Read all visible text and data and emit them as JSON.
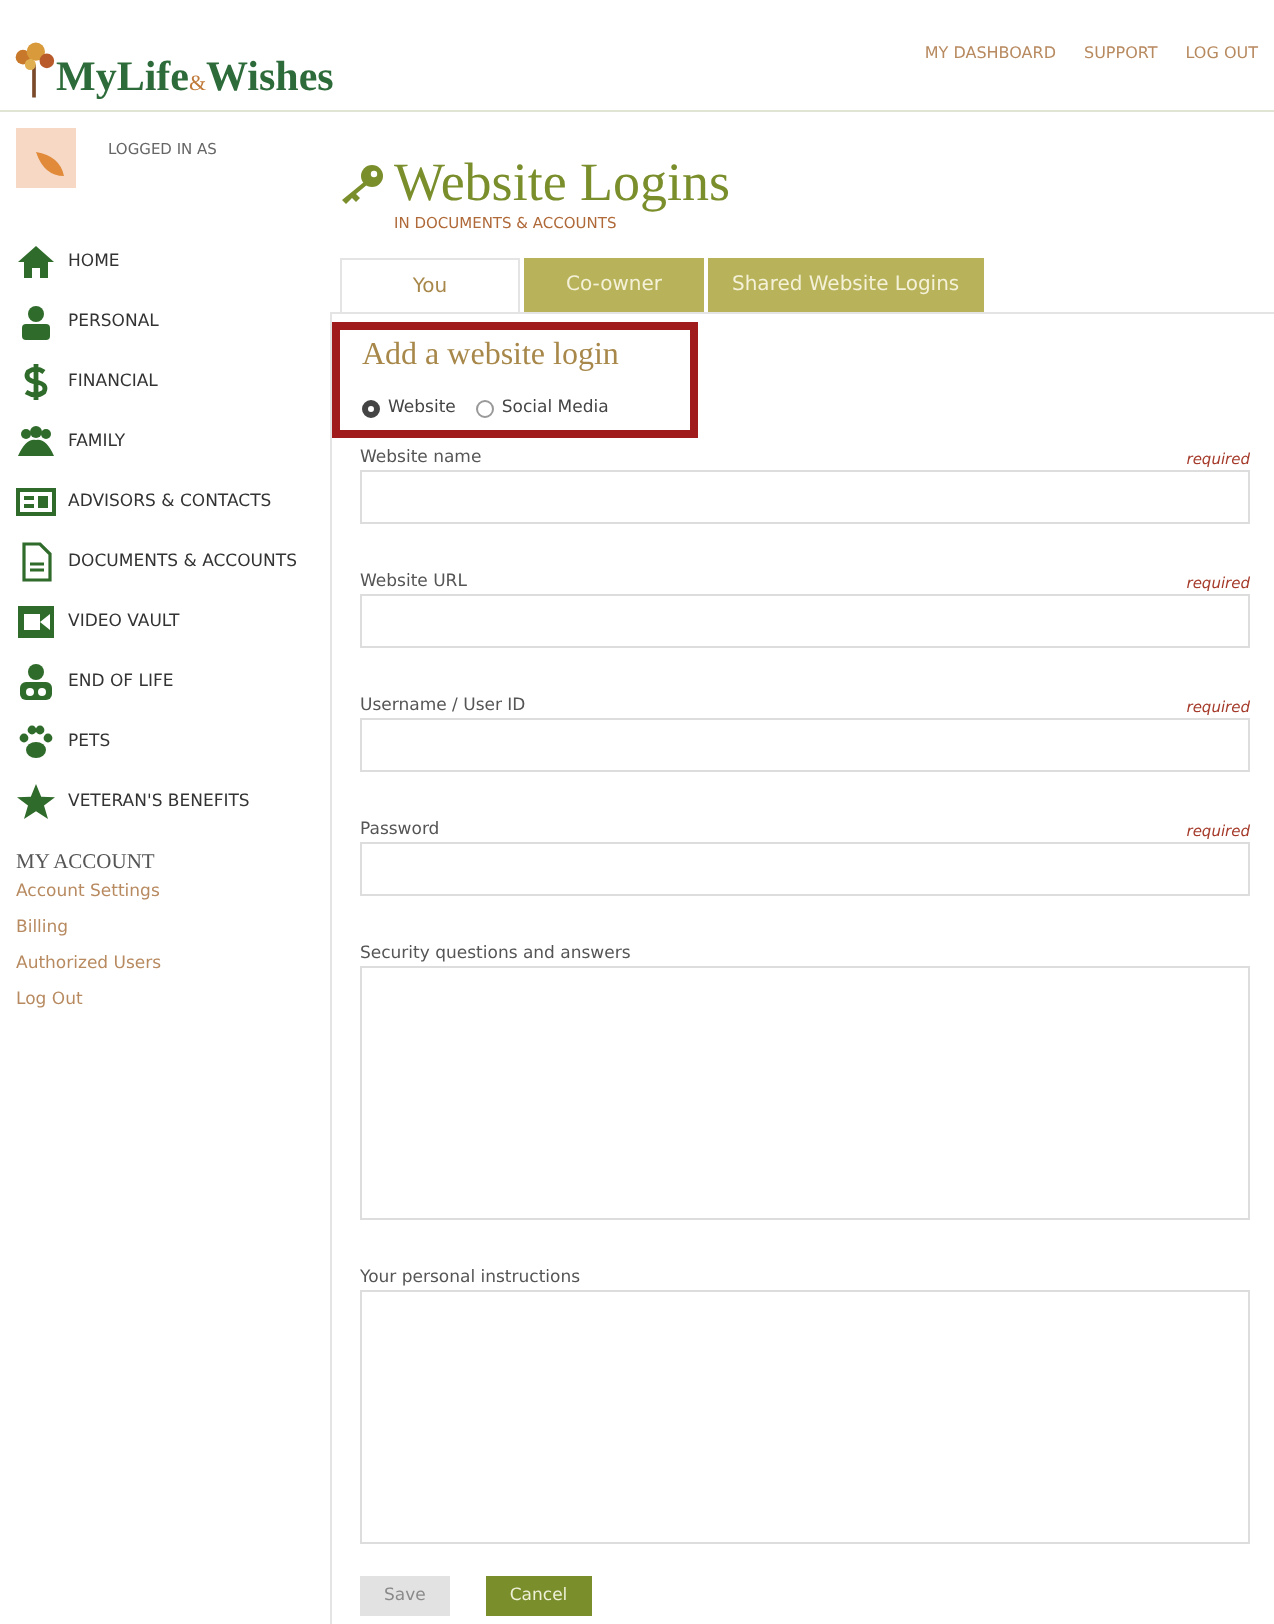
{
  "header": {
    "logo": [
      "MyLife",
      "&",
      "Wishes"
    ],
    "nav": [
      "MY DASHBOARD",
      "SUPPORT",
      "LOG OUT"
    ]
  },
  "user": {
    "label": "LOGGED IN AS"
  },
  "page": {
    "title": "Website Logins",
    "subtitle": "IN DOCUMENTS & ACCOUNTS"
  },
  "sidebar": {
    "items": [
      {
        "label": "HOME",
        "selected": false
      },
      {
        "label": "PERSONAL",
        "selected": false
      },
      {
        "label": "FINANCIAL",
        "selected": false
      },
      {
        "label": "FAMILY",
        "selected": false
      },
      {
        "label": "ADVISORS & CONTACTS",
        "selected": false
      },
      {
        "label": "DOCUMENTS & ACCOUNTS",
        "selected": false
      },
      {
        "label": "VIDEO VAULT",
        "selected": false
      },
      {
        "label": "END OF LIFE",
        "selected": false
      },
      {
        "label": "PETS",
        "selected": false
      },
      {
        "label": "VETERAN'S BENEFITS",
        "selected": false
      }
    ],
    "account_heading": "MY ACCOUNT",
    "account_links": [
      "Account Settings",
      "Billing",
      "Authorized Users",
      "Log Out"
    ]
  },
  "tabs": [
    {
      "label": "You",
      "selected": true
    },
    {
      "label": "Co-owner",
      "selected": false
    },
    {
      "label": "Shared Website Logins",
      "selected": false
    }
  ],
  "form": {
    "heading": "Add a website login",
    "type_options": [
      {
        "label": "Website",
        "selected": true
      },
      {
        "label": "Social Media",
        "selected": false
      }
    ],
    "fields": [
      {
        "label": "Website name",
        "required_note": "required",
        "kind": "text"
      },
      {
        "label": "Website URL",
        "required_note": "required",
        "kind": "text"
      },
      {
        "label": "Username / User ID",
        "required_note": "required",
        "kind": "text"
      },
      {
        "label": "Password",
        "required_note": "required",
        "kind": "text"
      },
      {
        "label": "Security questions and answers",
        "kind": "textarea"
      },
      {
        "label": "Your personal instructions",
        "kind": "textarea"
      }
    ],
    "buttons": [
      {
        "label": "Save",
        "disabled": true
      },
      {
        "label": "Cancel",
        "disabled": false
      }
    ]
  }
}
